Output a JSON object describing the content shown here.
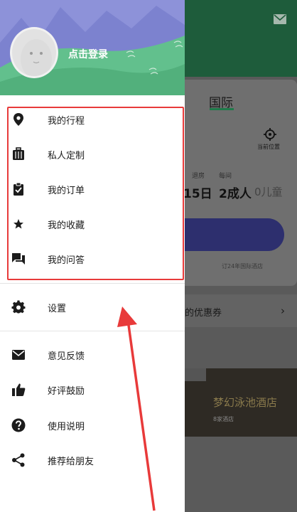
{
  "drawer": {
    "login_text": "点击登录",
    "group1": [
      {
        "label": "我的行程",
        "icon": "location-pin-icon"
      },
      {
        "label": "私人定制",
        "icon": "luggage-icon"
      },
      {
        "label": "我的订单",
        "icon": "clipboard-check-icon"
      },
      {
        "label": "我的收藏",
        "icon": "star-icon"
      },
      {
        "label": "我的问答",
        "icon": "chat-bubbles-icon"
      }
    ],
    "settings": {
      "label": "设置",
      "icon": "gear-icon"
    },
    "group2": [
      {
        "label": "意见反馈",
        "icon": "mail-icon"
      },
      {
        "label": "好评鼓励",
        "icon": "thumbs-up-icon"
      },
      {
        "label": "使用说明",
        "icon": "help-circle-icon"
      },
      {
        "label": "推荐给朋友",
        "icon": "share-icon"
      }
    ]
  },
  "background": {
    "tab": "国际",
    "location_label": "当前位置",
    "checkout_label": "退房",
    "guests_label": "每间",
    "date": "15日",
    "adults": "2成人",
    "children": "0儿童",
    "note": "订24年国际酒店",
    "coupon_text": "的优惠券",
    "hotel_name": "梦幻泳池酒店",
    "hotel_sub": "8家酒店"
  },
  "colors": {
    "drawer_header_sky": "#8a8fd6",
    "drawer_header_hill": "#5ec48f",
    "highlight": "#e83a3a",
    "arrow": "#e83a3a"
  }
}
